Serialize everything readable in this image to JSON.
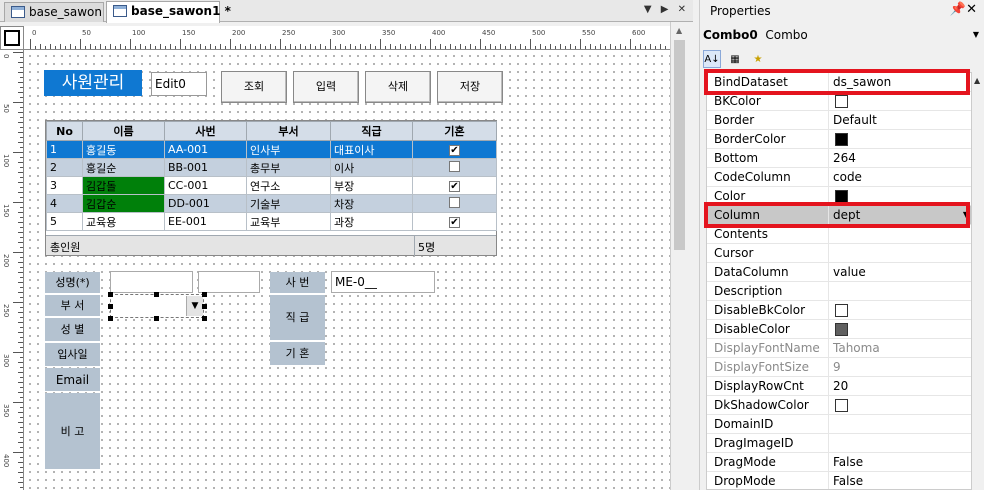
{
  "tabs": [
    {
      "label": "base_sawon",
      "active": false
    },
    {
      "label": "base_sawon1 *",
      "active": true
    }
  ],
  "tab_controls": "▼ ▶ ✕",
  "ruler": {
    "h_ticks": [
      "0",
      "50",
      "100",
      "150",
      "200",
      "250",
      "300",
      "350",
      "400",
      "450",
      "500",
      "550",
      "600"
    ],
    "v_ticks": [
      "0",
      "50",
      "100",
      "150",
      "200",
      "250",
      "300",
      "350",
      "400"
    ]
  },
  "form": {
    "title": "사원관리",
    "edit0": "Edit0",
    "buttons": [
      "조회",
      "입력",
      "삭제",
      "저장"
    ],
    "grid": {
      "headers": [
        "No",
        "이름",
        "사번",
        "부서",
        "직급",
        "기혼"
      ],
      "rows": [
        {
          "no": "1",
          "name": "홍길동",
          "id": "AA-001",
          "dept": "인사부",
          "rank": "대표이사",
          "married": true
        },
        {
          "no": "2",
          "name": "홍길순",
          "id": "BB-001",
          "dept": "총무부",
          "rank": "이사",
          "married": false
        },
        {
          "no": "3",
          "name": "김갑돌",
          "id": "CC-001",
          "dept": "연구소",
          "rank": "부장",
          "married": true
        },
        {
          "no": "4",
          "name": "김갑순",
          "id": "DD-001",
          "dept": "기술부",
          "rank": "차장",
          "married": false
        },
        {
          "no": "5",
          "name": "교육용",
          "id": "EE-001",
          "dept": "교육부",
          "rank": "과장",
          "married": true
        }
      ],
      "summary_label": "총인원",
      "summary_value": "5명"
    },
    "labels": {
      "name": "성명(*)",
      "dept": "부 서",
      "gender": "성 별",
      "joindate": "입사일",
      "email": "Email",
      "note": "비 고",
      "empno": "사 번",
      "rank": "직 급",
      "married": "기 혼"
    },
    "empno_value": "ME-0__"
  },
  "properties": {
    "panel_title": "Properties",
    "pin_icon": "📌✕",
    "object_name": "Combo0",
    "object_type": "Combo",
    "rows": [
      {
        "name": "BindDataset",
        "value": "ds_sawon",
        "highlight": true
      },
      {
        "name": "BKColor",
        "swatch": "#ffffff"
      },
      {
        "name": "Border",
        "value": "Default"
      },
      {
        "name": "BorderColor",
        "swatch": "#000000"
      },
      {
        "name": "Bottom",
        "value": "264"
      },
      {
        "name": "CodeColumn",
        "value": "code"
      },
      {
        "name": "Color",
        "swatch": "#000000"
      },
      {
        "name": "Column",
        "value": "dept",
        "highlight": true,
        "selected": true,
        "dropdown": true
      },
      {
        "name": "Contents",
        "value": ""
      },
      {
        "name": "Cursor",
        "value": ""
      },
      {
        "name": "DataColumn",
        "value": "value"
      },
      {
        "name": "Description",
        "value": ""
      },
      {
        "name": "DisableBkColor",
        "swatch": "#ffffff"
      },
      {
        "name": "DisableColor",
        "swatch": "#606060"
      },
      {
        "name": "DisplayFontName",
        "value": "Tahoma",
        "disabled": true
      },
      {
        "name": "DisplayFontSize",
        "value": "9",
        "disabled": true
      },
      {
        "name": "DisplayRowCnt",
        "value": "20"
      },
      {
        "name": "DkShadowColor",
        "swatch": "#ffffff"
      },
      {
        "name": "DomainID",
        "value": ""
      },
      {
        "name": "DragImageID",
        "value": ""
      },
      {
        "name": "DragMode",
        "value": "False"
      },
      {
        "name": "DropMode",
        "value": "False"
      }
    ]
  },
  "colors": {
    "selection": "#0f78d2",
    "highlight_box": "#e4141e",
    "green_cell": "#00800a"
  }
}
